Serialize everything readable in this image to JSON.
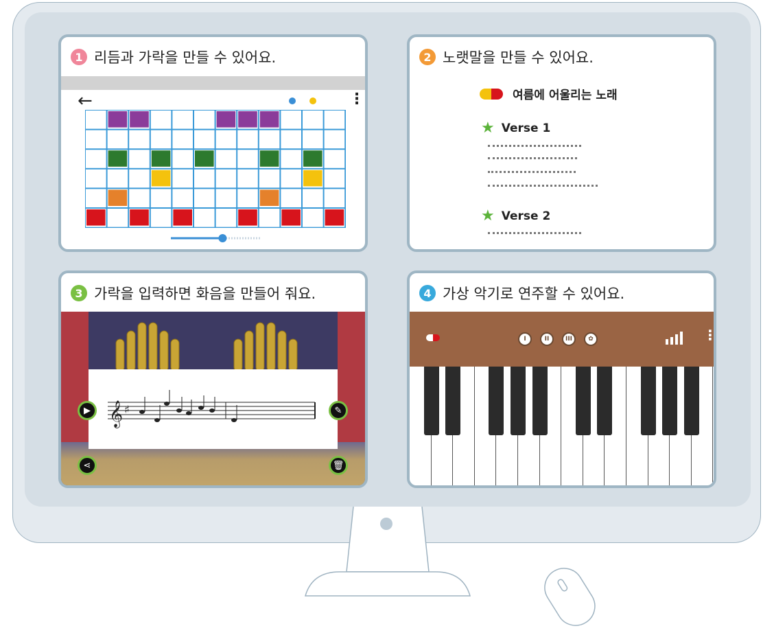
{
  "panels": [
    {
      "number": "1",
      "caption": "리듬과 가락을 만들 수 있어요.",
      "color": "#f0869a"
    },
    {
      "number": "2",
      "caption": "노랫말을 만들 수 있어요.",
      "color": "#f39a36"
    },
    {
      "number": "3",
      "caption": "가락을 입력하면 화음을 만들어 줘요.",
      "color": "#7ac043"
    },
    {
      "number": "4",
      "caption": "가상 악기로 연주할 수 있어요.",
      "color": "#38a9dc"
    }
  ],
  "lyrics": {
    "title": "여름에 어울리는 노래",
    "verses": [
      "Verse 1",
      "Verse 2"
    ]
  },
  "colors": {
    "purple": "#8b3c9a",
    "green": "#2d7a2e",
    "yellow": "#f4c20d",
    "orange": "#e5812b",
    "red": "#d7141c",
    "grid": "#3a9ad8",
    "slider": "#3a8fd6"
  },
  "rhythm_grid": {
    "cols": 12,
    "rows": 6,
    "notes": [
      {
        "col": 1,
        "row": 0,
        "color": "purple"
      },
      {
        "col": 2,
        "row": 0,
        "color": "purple"
      },
      {
        "col": 6,
        "row": 0,
        "color": "purple"
      },
      {
        "col": 7,
        "row": 0,
        "color": "purple"
      },
      {
        "col": 8,
        "row": 0,
        "color": "purple"
      },
      {
        "col": 1,
        "row": 2,
        "color": "green"
      },
      {
        "col": 3,
        "row": 2,
        "color": "green"
      },
      {
        "col": 5,
        "row": 2,
        "color": "green"
      },
      {
        "col": 8,
        "row": 2,
        "color": "green"
      },
      {
        "col": 10,
        "row": 2,
        "color": "green"
      },
      {
        "col": 3,
        "row": 3,
        "color": "yellow"
      },
      {
        "col": 10,
        "row": 3,
        "color": "yellow"
      },
      {
        "col": 1,
        "row": 4,
        "color": "orange"
      },
      {
        "col": 8,
        "row": 4,
        "color": "orange"
      },
      {
        "col": 0,
        "row": 5,
        "color": "red"
      },
      {
        "col": 2,
        "row": 5,
        "color": "red"
      },
      {
        "col": 4,
        "row": 5,
        "color": "red"
      },
      {
        "col": 7,
        "row": 5,
        "color": "red"
      },
      {
        "col": 9,
        "row": 5,
        "color": "red"
      },
      {
        "col": 11,
        "row": 5,
        "color": "red"
      }
    ],
    "tempo_progress": 0.58
  }
}
